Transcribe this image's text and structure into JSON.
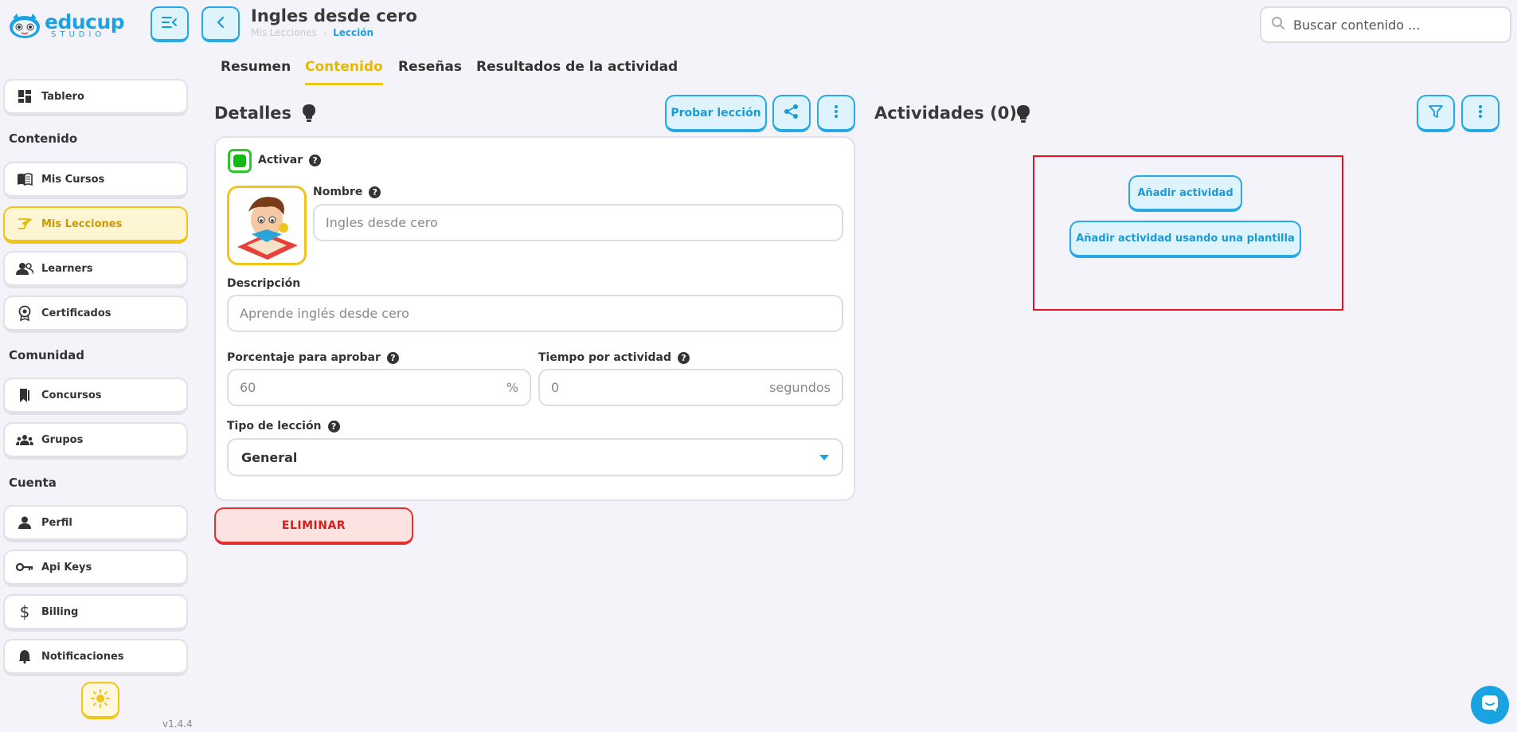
{
  "brand": {
    "name": "educup",
    "sub": "STUDIO"
  },
  "header": {
    "title": "Ingles desde cero",
    "breadcrumb": [
      "Mis Lecciones",
      "Lección"
    ],
    "search_placeholder": "Buscar contenido ..."
  },
  "sidebar": {
    "tablero": "Tablero",
    "section_contenido": "Contenido",
    "mis_cursos": "Mis Cursos",
    "mis_lecciones": "Mis Lecciones",
    "learners": "Learners",
    "certificados": "Certificados",
    "section_comunidad": "Comunidad",
    "concursos": "Concursos",
    "grupos": "Grupos",
    "section_cuenta": "Cuenta",
    "perfil": "Perfil",
    "api_keys": "Api Keys",
    "billing": "Billing",
    "notificaciones": "Notificaciones",
    "version": "v1.4.4"
  },
  "tabs": [
    {
      "label": "Resumen"
    },
    {
      "label": "Contenido"
    },
    {
      "label": "Reseñas"
    },
    {
      "label": "Resultados de la actividad"
    }
  ],
  "details": {
    "title": "Detalles",
    "probar_label": "Probar lección",
    "activar_label": "Activar",
    "activar_checked": true,
    "nombre_label": "Nombre",
    "nombre_value": "Ingles desde cero",
    "descripcion_label": "Descripción",
    "descripcion_value": "Aprende inglés desde cero",
    "porcentaje_label": "Porcentaje para aprobar",
    "porcentaje_value": "60",
    "porcentaje_suffix": "%",
    "tiempo_label": "Tiempo por actividad",
    "tiempo_value": "0",
    "tiempo_suffix": "segundos",
    "tipo_label": "Tipo de lección",
    "tipo_value": "General",
    "delete_label": "ELIMINAR"
  },
  "activities": {
    "title": "Actividades (0)",
    "add_label": "Añadir actividad",
    "add_template_label": "Añadir actividad usando una plantilla"
  },
  "colors": {
    "accent_blue": "#1aa3e3",
    "accent_yellow": "#f0c419",
    "danger": "#e53030",
    "success": "#14b814"
  }
}
